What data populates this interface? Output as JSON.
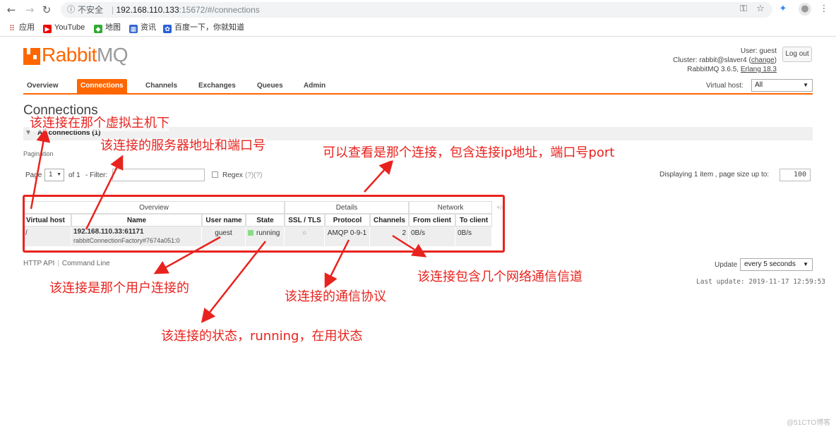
{
  "browser": {
    "security": "不安全",
    "url_host": "192.168.110.133",
    "url_rest": ":15672/#/connections",
    "bookmarks": [
      "应用",
      "YouTube",
      "地图",
      "资讯",
      "百度一下，你就知道"
    ]
  },
  "app": {
    "logo_main": "Rabbit",
    "logo_mq": "MQ",
    "user_line": "User: guest",
    "cluster_prefix": "Cluster: rabbit@slaver4 (",
    "cluster_change": "change",
    "cluster_suffix": ")",
    "version_prefix": "RabbitMQ 3.6.5, ",
    "erlang": "Erlang 18.3",
    "logout": "Log out",
    "vhost_label": "Virtual host:",
    "vhost_value": "All"
  },
  "tabs": [
    "Overview",
    "Connections",
    "Channels",
    "Exchanges",
    "Queues",
    "Admin"
  ],
  "page": {
    "title": "Connections",
    "section": "All connections (1)",
    "pagination_label": "Pagination",
    "page_label": "Page",
    "page_value": "1",
    "of_label": "of 1",
    "filter_label": "- Filter:",
    "regex_label": "Regex",
    "regex_help": "(?)(?)",
    "displaying": "Displaying 1 item , page size up to:",
    "page_size": "100"
  },
  "table": {
    "groups": [
      "Overview",
      "Details",
      "Network"
    ],
    "plus_minus": "+/-",
    "headers": [
      "Virtual host",
      "Name",
      "User name",
      "State",
      "SSL / TLS",
      "Protocol",
      "Channels",
      "From client",
      "To client"
    ],
    "row": {
      "vhost": "/",
      "name": "192.168.110.33:61171",
      "name_sub": "rabbitConnectionFactory#7674a051:0",
      "user": "guest",
      "state": "running",
      "ssl": "○",
      "protocol": "AMQP 0-9-1",
      "channels": "2",
      "from_client": "0B/s",
      "to_client": "0B/s"
    }
  },
  "footer": {
    "http_api": "HTTP API",
    "command_line": "Command Line",
    "update_label": "Update",
    "update_value": "every 5 seconds",
    "last_update": "Last update: 2019-11-17 12:59:53"
  },
  "annotations": {
    "vhost": "该连接在那个虚拟主机下",
    "server": "该连接的服务器地址和端口号",
    "which": "可以查看是那个连接，包含连接ip地址，端口号port",
    "user": "该连接是那个用户连接的",
    "state": "该连接的状态，running，在用状态",
    "protocol": "该连接的通信协议",
    "channels": "该连接包含几个网络通信信道"
  },
  "watermark": "@51CTO博客",
  "colors": {
    "accent": "#ff6600",
    "annotation": "#e8231e",
    "running": "#88dd88"
  }
}
